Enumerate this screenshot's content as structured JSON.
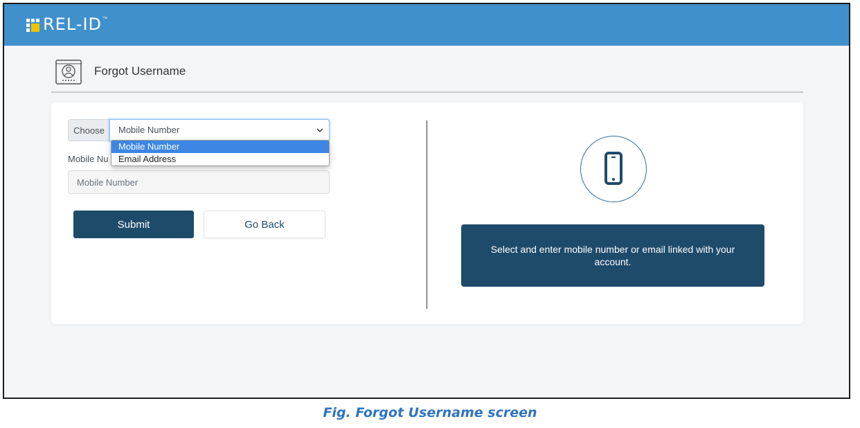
{
  "app": {
    "logo_text": "REL-ID",
    "logo_tm": "™"
  },
  "header": {
    "title": "Forgot Username"
  },
  "form": {
    "choose_label": "Choose",
    "choose_selected": "Mobile Number",
    "options": [
      "Mobile Number",
      "Email Address"
    ],
    "field_label": "Mobile Nu",
    "input_placeholder": "Mobile Number",
    "submit_label": "Submit",
    "back_label": "Go Back"
  },
  "info": {
    "message": "Select and enter mobile number or email linked with your account."
  },
  "caption": "Fig. Forgot Username screen",
  "colors": {
    "topbar": "#4090cc",
    "primary": "#1f4b6b",
    "highlight": "#3d86e3",
    "caption": "#2f74c0"
  },
  "icons": {
    "header": "user-badge-icon",
    "select": "chevron-down-icon",
    "info": "mobile-phone-icon"
  }
}
